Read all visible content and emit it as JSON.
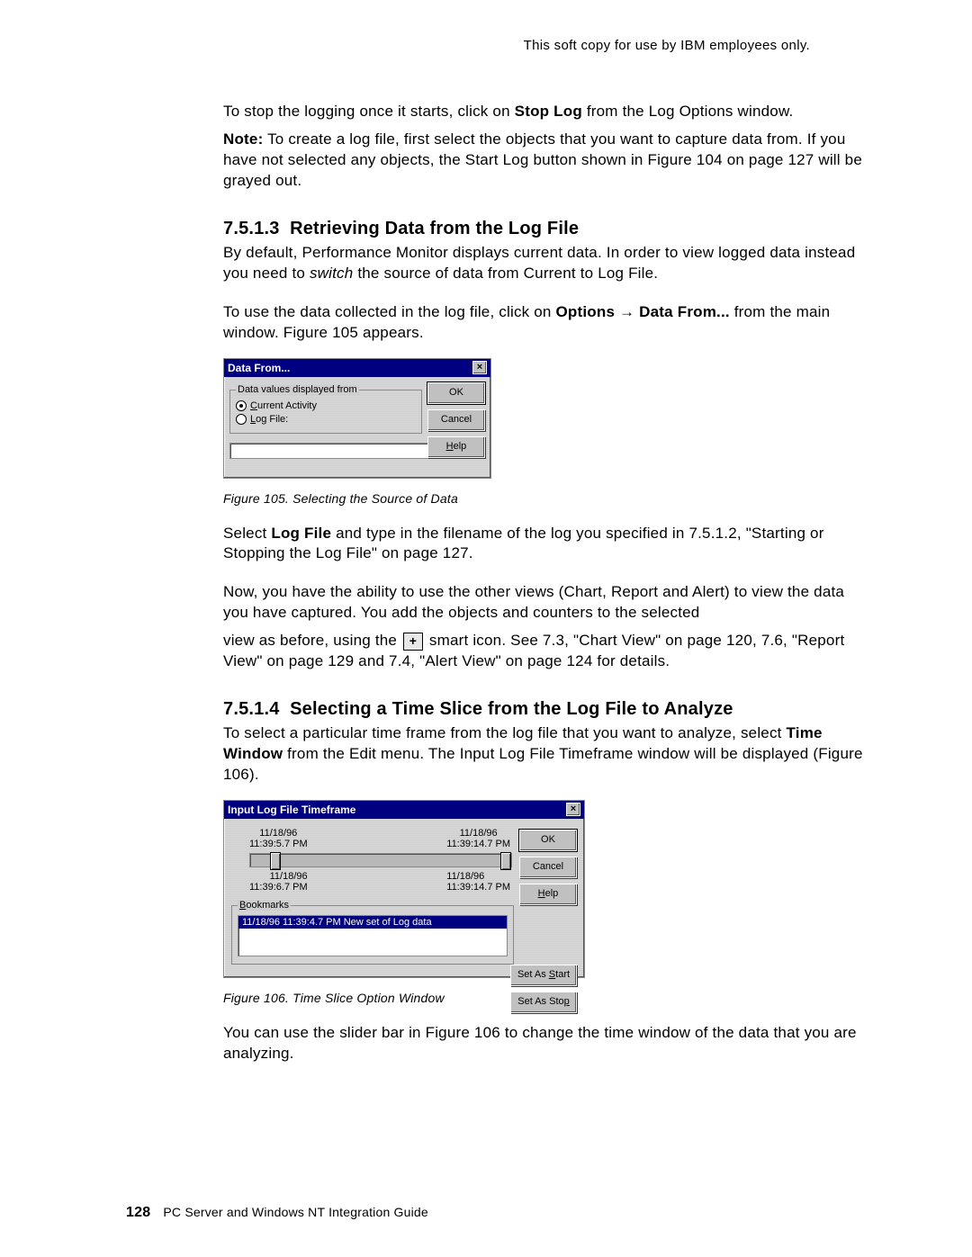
{
  "header": {
    "note": "This soft copy for use by IBM employees only."
  },
  "para1": {
    "a": "To stop the logging once it starts, click on ",
    "b": "Stop Log",
    "c": " from the Log Options window."
  },
  "para2": {
    "a": "Note:",
    "b": "  To create a log file, first select the objects that you want to capture data from.  If you have not selected any objects, the Start Log button shown in Figure 104 on page 127 will be grayed out."
  },
  "sec1": {
    "num": "7.5.1.3",
    "title": "Retrieving Data from the Log File",
    "p1a": "By default, Performance Monitor displays current data.  In order to view logged data instead you need to ",
    "p1b": "switch",
    "p1c": " the source of data from Current to Log File.",
    "p2a": "To use the data collected in the log file, click on ",
    "p2b": "Options",
    "arrow": " → ",
    "p2c": "Data From...",
    "p2d": " from the main window.  Figure 105 appears."
  },
  "dlg1": {
    "title": "Data From...",
    "group": "Data values displayed from",
    "opt1_u": "C",
    "opt1": "urrent Activity",
    "opt2_u": "L",
    "opt2": "og File:",
    "browse": "...",
    "ok": "OK",
    "cancel": "Cancel",
    "help_u": "H",
    "help": "elp"
  },
  "cap1": "Figure 105.  Selecting the Source of Data",
  "sec1b": {
    "p1a": "Select ",
    "p1b": "Log File",
    "p1c": " and type in the filename of the log you specified in 7.5.1.2, \"Starting or Stopping the Log File\" on page 127.",
    "p2": "Now, you have the ability to use the other views (Chart, Report and Alert) to view the data you have captured.  You add the objects and counters to the selected",
    "p3a": "view as before, using the ",
    "p3b": " smart icon.  See 7.3, \"Chart View\" on page 120, 7.6, \"Report View\" on page 129 and 7.4, \"Alert View\" on page 124 for details."
  },
  "sec2": {
    "num": "7.5.1.4",
    "title": "Selecting a Time Slice from the Log File to Analyze",
    "p1a": "To select a particular time frame from the log file that you want to analyze, select ",
    "p1b": "Time Window",
    "p1c": " from the Edit menu.  The Input Log File Timeframe window will be displayed (Figure 106)."
  },
  "dlg2": {
    "title": "Input Log File Timeframe",
    "t1d": "11/18/96",
    "t1t": "11:39:5.7 PM",
    "t2d": "11/18/96",
    "t2t": "11:39:14.7 PM",
    "b1d": "11/18/96",
    "b1t": "11:39:6.7 PM",
    "b2d": "11/18/96",
    "b2t": "11:39:14.7 PM",
    "group_u": "B",
    "group": "ookmarks",
    "bookmark": "11/18/96  11:39:4.7 PM   New set of Log data",
    "ok": "OK",
    "cancel": "Cancel",
    "help_u": "H",
    "help": "elp",
    "start_a": "Set As ",
    "start_u": "S",
    "start_b": "tart",
    "stop_a": "Set As Sto",
    "stop_u": "p"
  },
  "cap2": "Figure 106.  Time Slice Option Window",
  "para_last": "You can use the slider bar in Figure 106 to change the time window of the data that you are analyzing.",
  "footer": {
    "pn": "128",
    "txt": "PC Server and Windows NT Integration Guide"
  }
}
